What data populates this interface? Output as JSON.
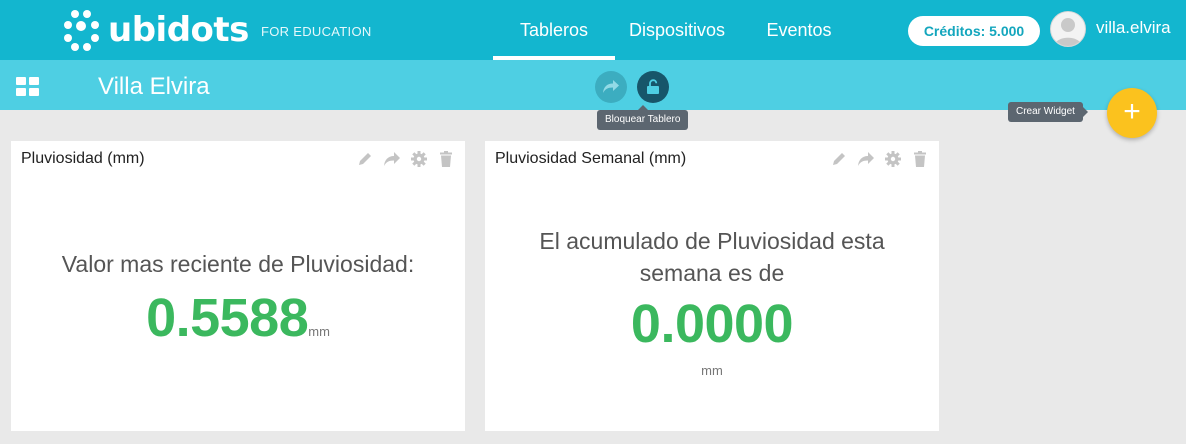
{
  "header": {
    "logo_text": "ubidots",
    "logo_subtitle": "FOR EDUCATION",
    "nav": [
      {
        "label": "Tableros",
        "active": true
      },
      {
        "label": "Dispositivos",
        "active": false
      },
      {
        "label": "Eventos",
        "active": false
      }
    ],
    "credits_label": "Créditos: 5.000",
    "username": "villa.elvira"
  },
  "subheader": {
    "board_title": "Villa Elvira",
    "lock_tooltip": "Bloquear Tablero",
    "add_widget_tooltip": "Crear Widget",
    "add_widget_symbol": "+"
  },
  "widgets": [
    {
      "title": "Pluviosidad (mm)",
      "label": "Valor mas reciente de Pluviosidad:",
      "value": "0.5588",
      "unit": "mm"
    },
    {
      "title": "Pluviosidad Semanal (mm)",
      "label": "El acumulado de Pluviosidad esta semana  es de",
      "value": "0.0000",
      "unit": "mm"
    }
  ],
  "colors": {
    "topbar": "#13b6cf",
    "subbar": "#4ecfe3",
    "value_green": "#3bb85e",
    "fab_yellow": "#fbc21e"
  }
}
